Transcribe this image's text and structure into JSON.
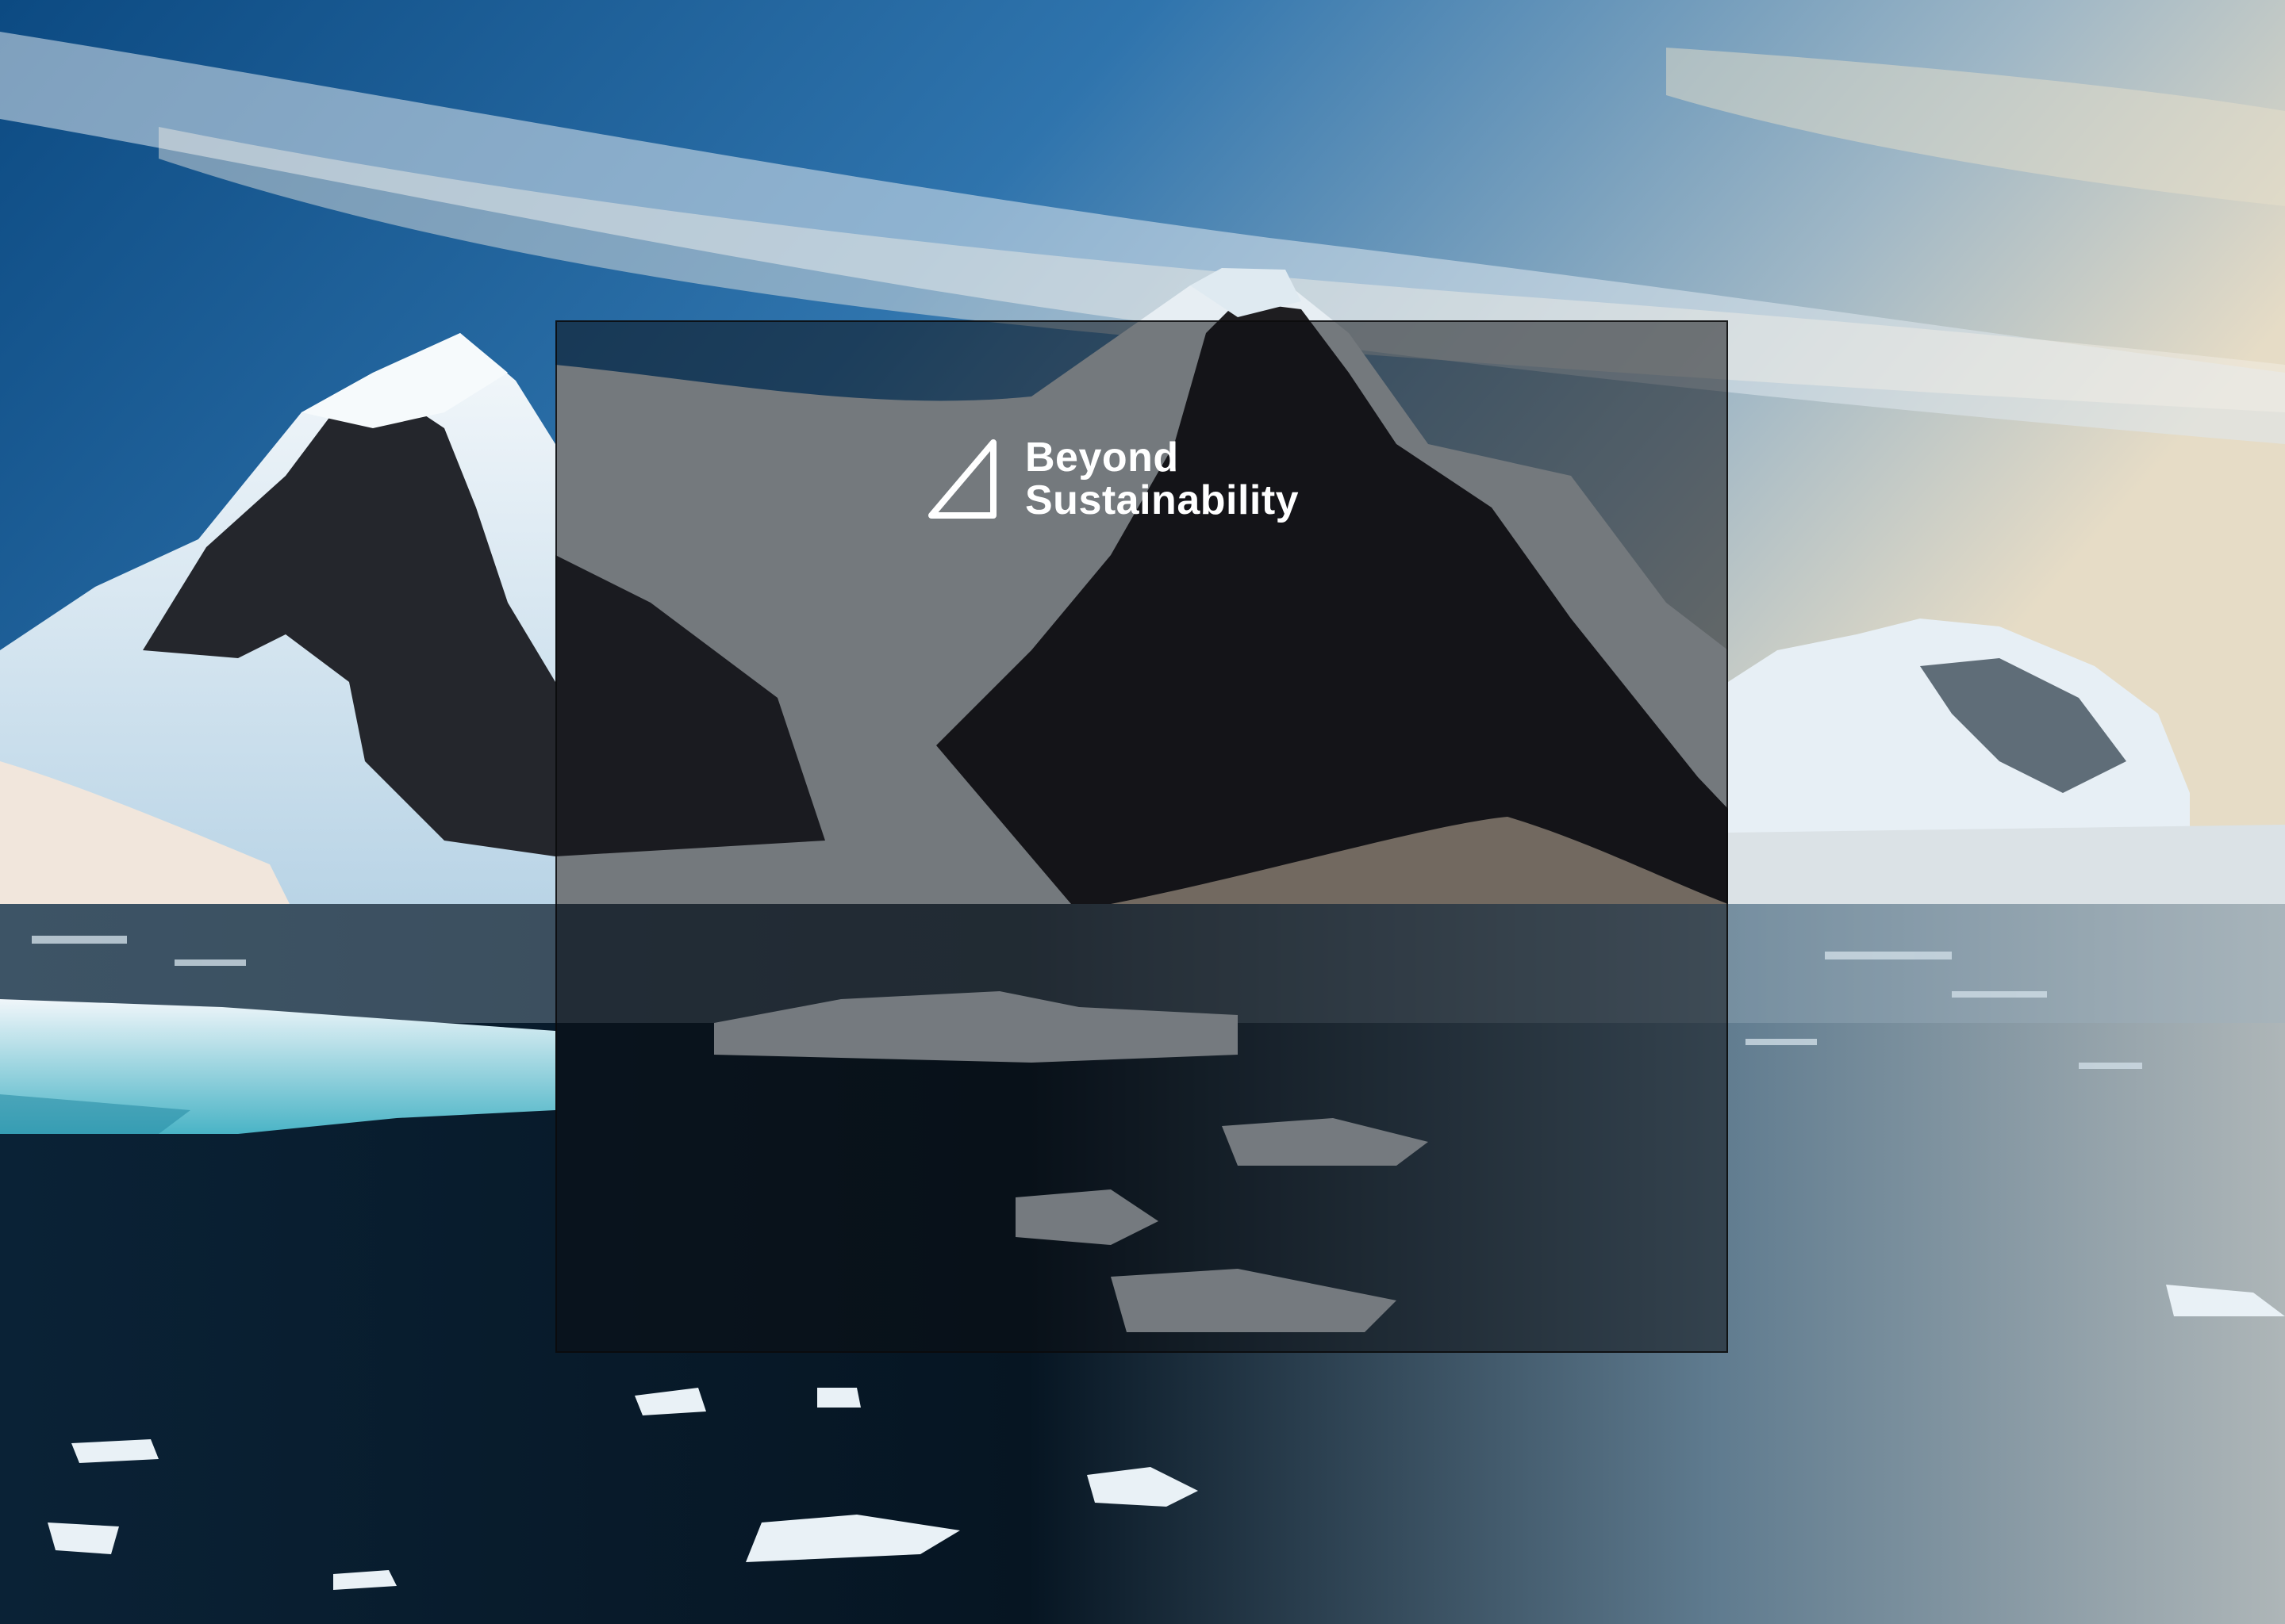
{
  "background": {
    "icon": "antarctic-landscape-photo",
    "colors": {
      "sky_top": "#0f4f86",
      "sky_mid": "#3f7fb0",
      "sky_haze": "#e9e2d2",
      "ice": "#eef4f8",
      "rock": "#2a2b30",
      "water": "#0b2236"
    }
  },
  "overlay": {
    "color": "#0c0e12"
  },
  "brand": {
    "icon": "triangle-logo-icon",
    "line1": "Beyond",
    "line2": "Sustainability",
    "color": "#ffffff"
  }
}
